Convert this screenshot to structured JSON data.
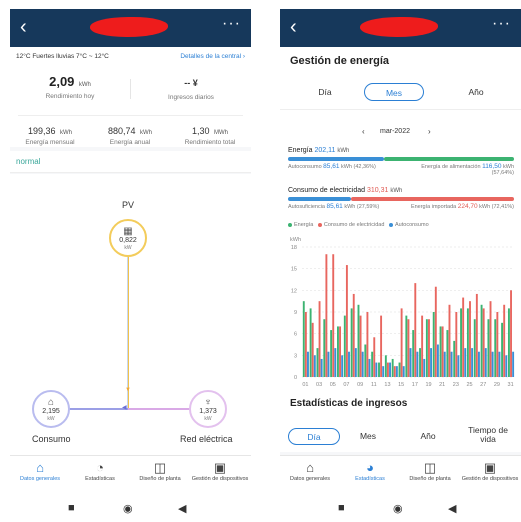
{
  "phone1": {
    "weather": "12°C  Fuertes lluvias 7°C ~ 12°C",
    "details_link": "Detalles de la central",
    "yield_today": {
      "value": "2,09",
      "unit": "kWh",
      "label": "Rendimiento hoy"
    },
    "daily_income": {
      "value": "-- ¥",
      "label": "Ingresos diarios"
    },
    "monthly": {
      "value": "199,36",
      "unit": "kWh",
      "label": "Energía mensual"
    },
    "annual": {
      "value": "880,74",
      "unit": "kWh",
      "label": "Energía anual"
    },
    "total": {
      "value": "1,30",
      "unit": "MWh",
      "label": "Rendimiento total"
    },
    "status": "normal",
    "pv_label": "PV",
    "pv_value": "0,822",
    "pv_unit": "kW",
    "consumo_value": "2,195",
    "consumo_unit": "kW",
    "consumo_label": "Consumo",
    "grid_value": "1,373",
    "grid_unit": "kW",
    "grid_label": "Red eléctrica"
  },
  "phone2": {
    "title": "Gestión de energía",
    "tabs": [
      "Día",
      "Mes",
      "Año"
    ],
    "period": "mar-2022",
    "energia_label": "Energía",
    "energia_value": "202,11",
    "energia_unit": "kWh",
    "autoconsumo_label": "Autoconsumo",
    "autoconsumo_value": "85,61",
    "autoconsumo_rest": "kWh (42,36%)",
    "alim_label": "Energía de alimentación",
    "alim_value": "116,50",
    "alim_unit": "kWh",
    "alim_pct": "(57,64%)",
    "consumo_label": "Consumo de electricidad",
    "consumo_value": "310,31",
    "consumo_unit": "kWh",
    "autosuf_label": "Autosuficiencia",
    "autosuf_value": "85,61",
    "autosuf_rest": "kWh (27,59%)",
    "importada_label": "Energía importada",
    "importada_value": "224,70",
    "importada_rest": "kWh (72,41%)",
    "ingresos_title": "Estadísticas de ingresos",
    "ingresos_tabs": [
      "Día",
      "Mes",
      "Año",
      "Tiempo de vida"
    ]
  },
  "nav": {
    "items": [
      "Datos generales",
      "Estadísticas",
      "Diseño de planta",
      "Gestión de dispositivos"
    ]
  },
  "colors": {
    "energia": "#3cb371",
    "consumo": "#e8665f",
    "autoconsumo": "#3a8fd6",
    "appbar": "#16385b",
    "accent": "#2b7fd4"
  },
  "chart_data": {
    "type": "bar",
    "ylabel": "kWh",
    "ylim": [
      0,
      18
    ],
    "yticks": [
      0,
      3,
      6,
      9,
      12,
      15,
      18
    ],
    "xticks": [
      "01",
      "03",
      "05",
      "07",
      "09",
      "11",
      "13",
      "15",
      "17",
      "19",
      "21",
      "23",
      "25",
      "27",
      "29",
      "31"
    ],
    "categories": [
      "01",
      "02",
      "03",
      "04",
      "05",
      "06",
      "07",
      "08",
      "09",
      "10",
      "11",
      "12",
      "13",
      "14",
      "15",
      "16",
      "17",
      "18",
      "19",
      "20",
      "21",
      "22",
      "23",
      "24",
      "25",
      "26",
      "27",
      "28",
      "29",
      "30",
      "31"
    ],
    "series": [
      {
        "name": "Energía",
        "values": [
          10.5,
          9.5,
          4.0,
          8.0,
          6.5,
          7.0,
          8.5,
          9.5,
          10.0,
          4.5,
          3.5,
          2.0,
          3.0,
          2.5,
          2.0,
          8.5,
          6.5,
          4.0,
          8.0,
          9.0,
          7.0,
          6.5,
          5.0,
          9.5,
          9.5,
          8.0,
          10.0,
          8.0,
          8.0,
          7.5,
          9.5
        ]
      },
      {
        "name": "Consumo de electricidad",
        "values": [
          9.0,
          7.5,
          10.5,
          17.0,
          17.0,
          7.0,
          15.5,
          11.5,
          8.5,
          9.0,
          5.5,
          8.5,
          2.0,
          1.5,
          9.5,
          8.0,
          13.0,
          8.5,
          8.0,
          12.5,
          7.0,
          10.0,
          9.0,
          11.0,
          10.5,
          11.5,
          9.5,
          10.5,
          9.0,
          10.0,
          12.0
        ]
      },
      {
        "name": "Autoconsumo",
        "values": [
          3.5,
          3.0,
          2.5,
          3.5,
          4.0,
          3.0,
          3.5,
          4.0,
          3.5,
          2.5,
          2.0,
          1.5,
          2.0,
          1.5,
          1.5,
          4.0,
          3.5,
          2.5,
          4.0,
          4.5,
          3.5,
          3.5,
          3.0,
          4.0,
          4.0,
          3.5,
          4.0,
          3.5,
          3.5,
          3.0,
          3.5
        ]
      }
    ]
  }
}
